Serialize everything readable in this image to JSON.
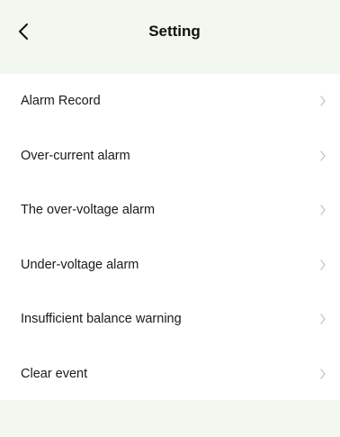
{
  "header": {
    "title": "Setting"
  },
  "icons": {
    "back": "chevron-left-icon",
    "row_arrow": "chevron-right-icon"
  },
  "colors": {
    "background": "#f2f7f0",
    "list_background": "#ffffff",
    "text": "#1a1a1a",
    "chevron": "#c4c4c4"
  },
  "settings": {
    "items": [
      {
        "label": "Alarm Record"
      },
      {
        "label": "Over-current alarm"
      },
      {
        "label": "The over-voltage alarm"
      },
      {
        "label": "Under-voltage alarm"
      },
      {
        "label": "Insufficient balance warning"
      },
      {
        "label": "Clear event"
      }
    ]
  }
}
